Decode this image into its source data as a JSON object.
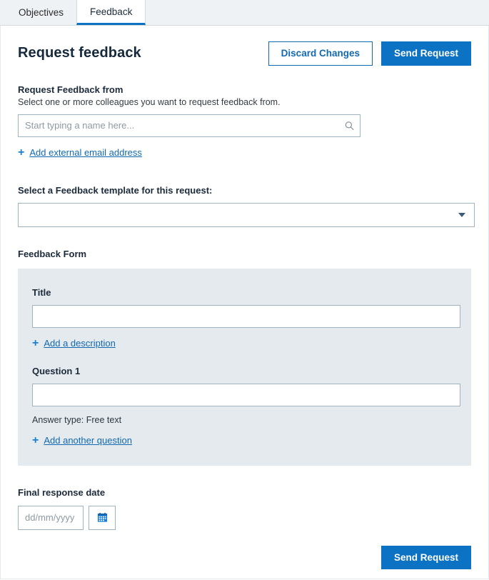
{
  "tabs": [
    {
      "label": "Objectives",
      "active": false
    },
    {
      "label": "Feedback",
      "active": true
    }
  ],
  "header": {
    "title": "Request feedback",
    "discard_label": "Discard Changes",
    "send_label": "Send Request"
  },
  "request_from": {
    "label": "Request Feedback from",
    "help": "Select one or more colleagues you want to request feedback from.",
    "placeholder": "Start typing a name here...",
    "value": "",
    "search_icon": "search-icon",
    "add_external_label": "Add external email address",
    "plus_glyph": "+"
  },
  "template": {
    "label": "Select a Feedback template for this request:",
    "selected": "",
    "caret_icon": "chevron-down-icon"
  },
  "feedback_form": {
    "label": "Feedback Form",
    "title_label": "Title",
    "title_value": "",
    "add_description_label": "Add a description",
    "question_label": "Question 1",
    "question_value": "",
    "answer_type": "Answer type: Free text",
    "add_question_label": "Add another question"
  },
  "final_date": {
    "label": "Final response date",
    "placeholder": "dd/mm/yyyy",
    "value": "",
    "calendar_icon": "calendar-icon"
  },
  "footer": {
    "send_label": "Send Request"
  },
  "colors": {
    "accent_blue": "#0b72c4",
    "link_blue": "#1269b0",
    "panel_bg": "#e4eaed",
    "tabstrip_bg": "#eef2f4",
    "input_border": "#9fb3c0"
  }
}
